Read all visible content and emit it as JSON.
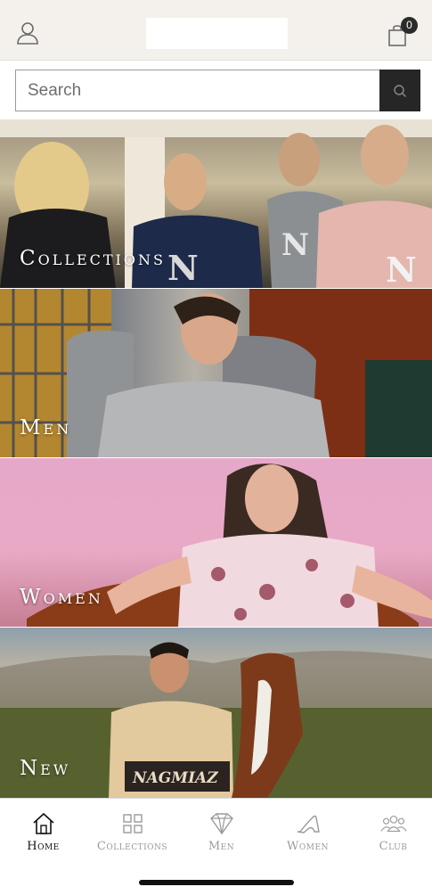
{
  "header": {
    "profile_icon": "user-icon",
    "cart_icon": "shopping-bag-icon",
    "cart_count": "0"
  },
  "search": {
    "placeholder": "Search",
    "button_icon": "search-icon"
  },
  "banners": [
    {
      "label": "Collections"
    },
    {
      "label": "Men"
    },
    {
      "label": "Women"
    },
    {
      "label": "New"
    }
  ],
  "bottom_nav": {
    "items": [
      {
        "label": "Home",
        "icon": "home-icon",
        "active": true
      },
      {
        "label": "Collections",
        "icon": "grid-icon",
        "active": false
      },
      {
        "label": "Men",
        "icon": "diamond-shirt-icon",
        "active": false
      },
      {
        "label": "Women",
        "icon": "high-heel-icon",
        "active": false
      },
      {
        "label": "Club",
        "icon": "group-icon",
        "active": false
      }
    ]
  },
  "colors": {
    "header_bg": "#f4f1ec",
    "search_button_bg": "#262626",
    "active_nav": "#111111",
    "inactive_nav": "#9a9a9a"
  }
}
